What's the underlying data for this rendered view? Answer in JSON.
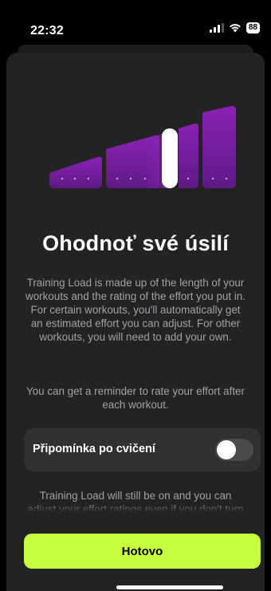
{
  "status_bar": {
    "time": "22:32",
    "battery": "88"
  },
  "sheet": {
    "title": "Ohodnoť své úsilí",
    "description": "Training Load is made up of the length of your workouts and the rating of the effort you put in. For certain workouts, you'll automatically get an estimated effort you can adjust. For other workouts, you will need to add your own.",
    "reminder_text": "You can get a reminder to rate your effort after each workout.",
    "toggle": {
      "label": "Připomínka po cvičení",
      "on": false
    },
    "footnote": "Training Load will still be on and you can adjust your effort ratings even if you don't turn on",
    "done_label": "Hotovo"
  },
  "colors": {
    "accent": "#c7ff3d",
    "bars": "#7a1fa2",
    "background": "#232324"
  },
  "icons": [
    "signal-icon",
    "wifi-icon",
    "battery-icon",
    "effort-bars-graphic"
  ]
}
